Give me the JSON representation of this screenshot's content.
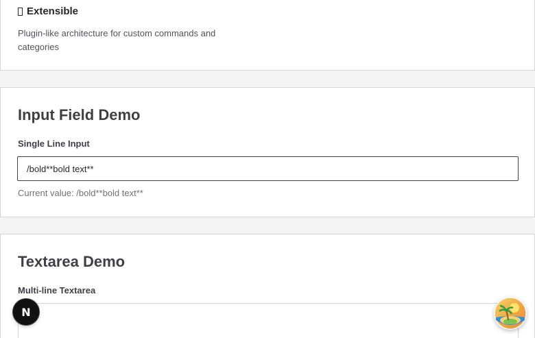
{
  "features": {
    "extensible_title": "Extensible",
    "extensible_glyph": "",
    "extensible_desc": "Plugin-like architecture for custom commands and categories"
  },
  "input_demo": {
    "title": "Input Field Demo",
    "label": "Single Line Input",
    "value": "/bold**bold text**",
    "current_value_text": "Current value: /bold**bold text**"
  },
  "textarea_demo": {
    "title": "Textarea Demo",
    "label": "Multi-line Textarea",
    "value": ""
  },
  "next_badge": {
    "letter": "N"
  },
  "icons": {
    "next_badge_icon": "nextjs-logo-icon",
    "island_icon": "island-palm-tree-icon"
  },
  "colors": {
    "page_bg": "#f4f4f5",
    "card_bg": "#ffffff",
    "border": "#d4d4d8",
    "text_dark": "#27272a",
    "text_muted": "#71717a"
  }
}
